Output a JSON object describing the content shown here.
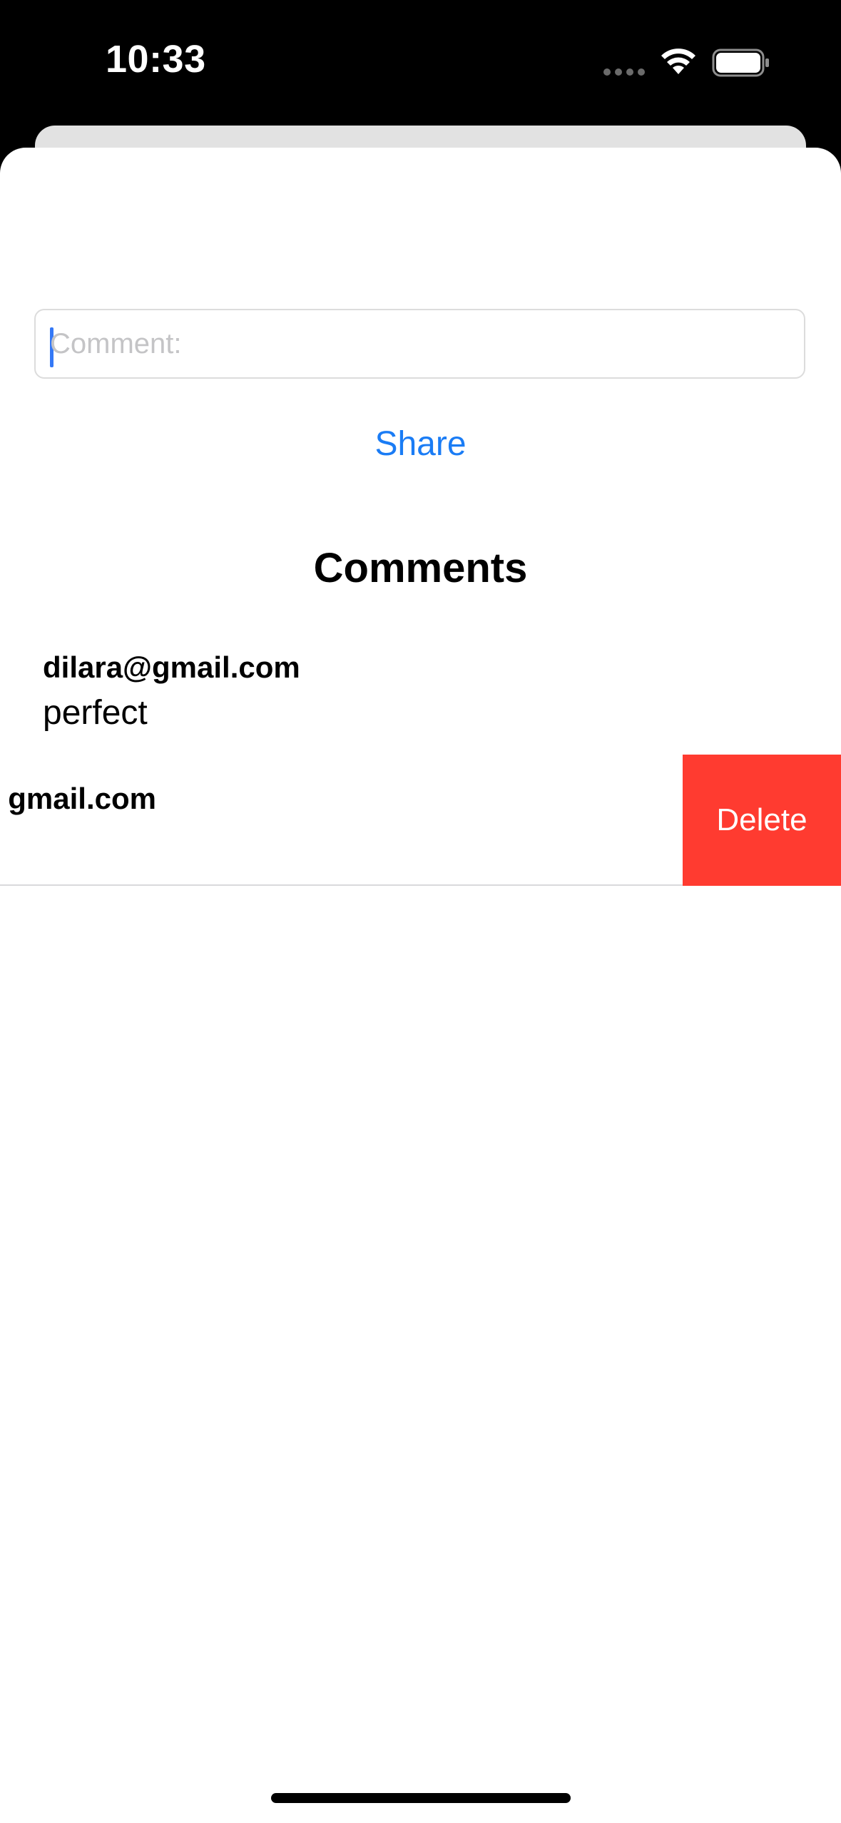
{
  "status_bar": {
    "time": "10:33",
    "icons": [
      "cellular-signal-icon",
      "wifi-icon",
      "battery-icon"
    ]
  },
  "comment_input": {
    "placeholder": "Comment:",
    "value": ""
  },
  "share_button": {
    "label": "Share"
  },
  "comments_section": {
    "title": "Comments",
    "items": [
      {
        "email": "dilara@gmail.com",
        "text": "perfect"
      },
      {
        "email": "gmail.com",
        "text": ""
      }
    ]
  },
  "swipe_actions": {
    "delete_label": "Delete"
  },
  "colors": {
    "accent": "#1a7cf5",
    "destructive": "#ff3b30",
    "caret": "#3478f6",
    "separator": "#d9d9dc"
  }
}
